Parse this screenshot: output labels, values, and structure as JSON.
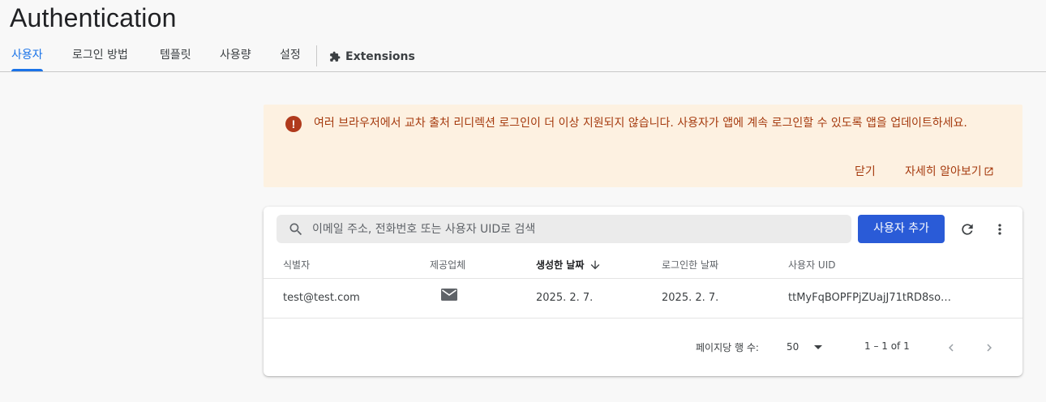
{
  "page": {
    "title": "Authentication"
  },
  "tabs": [
    {
      "label": "사용자",
      "active": true
    },
    {
      "label": "로그인 방법"
    },
    {
      "label": "템플릿"
    },
    {
      "label": "사용량"
    },
    {
      "label": "설정"
    },
    {
      "label": "Extensions",
      "icon": "puzzle-icon"
    }
  ],
  "banner": {
    "icon": "error-icon",
    "message": "여러 브라우저에서 교차 출처 리디렉션 로그인이 더 이상 지원되지 않습니다. 사용자가 앱에 계속 로그인할 수 있도록 앱을 업데이트하세요.",
    "dismiss_label": "닫기",
    "learn_more_label": "자세히 알아보기",
    "learn_more_icon": "open-in-new-icon",
    "color": "#a53a0e",
    "background": "#fdf1e1"
  },
  "users_table": {
    "search": {
      "placeholder": "이메일 주소, 전화번호 또는 사용자 UID로 검색",
      "value": ""
    },
    "add_user_label": "사용자 추가",
    "refresh_icon": "refresh-icon",
    "more_icon": "more-vert-icon",
    "columns": {
      "identifier": "식별자",
      "provider": "제공업체",
      "created": "생성한 날짜",
      "signed_in": "로그인한 날짜",
      "uid": "사용자 UID"
    },
    "sort": {
      "column": "created",
      "direction": "descending"
    },
    "rows": [
      {
        "identifier": "test@test.com",
        "provider_icon": "email-icon",
        "created": "2025. 2. 7.",
        "signed_in": "2025. 2. 7.",
        "uid": "ttMyFqBOPFPjZUajJ71tRD8so…"
      }
    ],
    "pagination": {
      "rows_per_page_label": "페이지당 행 수:",
      "rows_per_page": "50",
      "range": "1 – 1 of 1"
    }
  },
  "colors": {
    "accent": "#1a73e8",
    "primary_button": "#2a5bd7"
  }
}
